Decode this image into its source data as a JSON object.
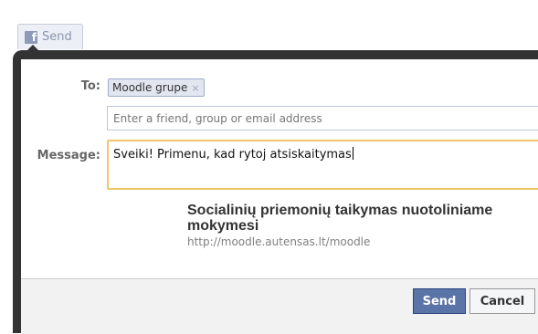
{
  "tab": {
    "icon": "facebook-logo-icon",
    "logo_letter": "f",
    "label": "Send"
  },
  "form": {
    "to_label": "To:",
    "recipient": "Moodle grupe",
    "recipient_remove": "×",
    "friend_placeholder": "Enter a friend, group or email address",
    "message_label": "Message:",
    "message_value": "Sveiki! Primenu, kad rytoj atsiskaitymas"
  },
  "preview": {
    "title": "Socialinių priemonių taikymas nuotoliniame mokymesi",
    "url": "http://moodle.autensas.lt/moodle"
  },
  "footer": {
    "send_label": "Send",
    "cancel_label": "Cancel"
  },
  "colors": {
    "dialog_border": "#333333",
    "send_button": "#5b74a8",
    "message_focus_border": "#f0c56c"
  }
}
